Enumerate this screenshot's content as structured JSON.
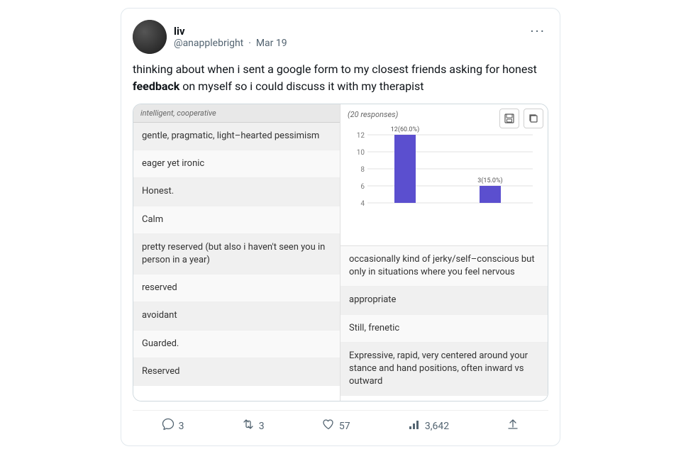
{
  "tweet": {
    "user_name": "liv",
    "user_handle": "@anapplebright",
    "date": "Mar 19",
    "more_button_label": "···",
    "text_part1": "thinking about when i sent a google form to my closest friends asking for honest ",
    "text_bold": "feedback",
    "text_part2": " on myself so i could discuss it with my therapist"
  },
  "form": {
    "left_header": "intelligent, cooperative",
    "right_header": "(20 responses)",
    "left_rows": [
      "gentle, pragmatic, light–hearted pessimism",
      "eager yet ironic",
      "Honest.",
      "Calm",
      "pretty reserved (but also i haven't seen you in person in a year)",
      "reserved",
      "avoidant",
      "Guarded.",
      "Reserved"
    ],
    "right_rows": [
      "occasionally kind of jerky/self–conscious but only in situations where you feel nervous",
      "appropriate",
      "Still, frenetic",
      "Expressive, rapid, very centered around your stance and hand positions, often inward vs outward"
    ],
    "chart": {
      "bar1_value": 12,
      "bar1_label": "12(60.0%)",
      "bar2_value": 3,
      "bar2_label": "3(15.0%)",
      "y_labels": [
        "12",
        "10",
        "8",
        "6",
        "4"
      ],
      "bar_color": "#5b4fcf"
    }
  },
  "footer": {
    "comments_count": "3",
    "retweets_count": "3",
    "likes_count": "57",
    "views_count": "3,642"
  },
  "icons": {
    "comment": "○",
    "retweet": "↺",
    "like": "♡",
    "views": "📊",
    "share": "↑",
    "save": "⊡",
    "copy": "⧉"
  }
}
